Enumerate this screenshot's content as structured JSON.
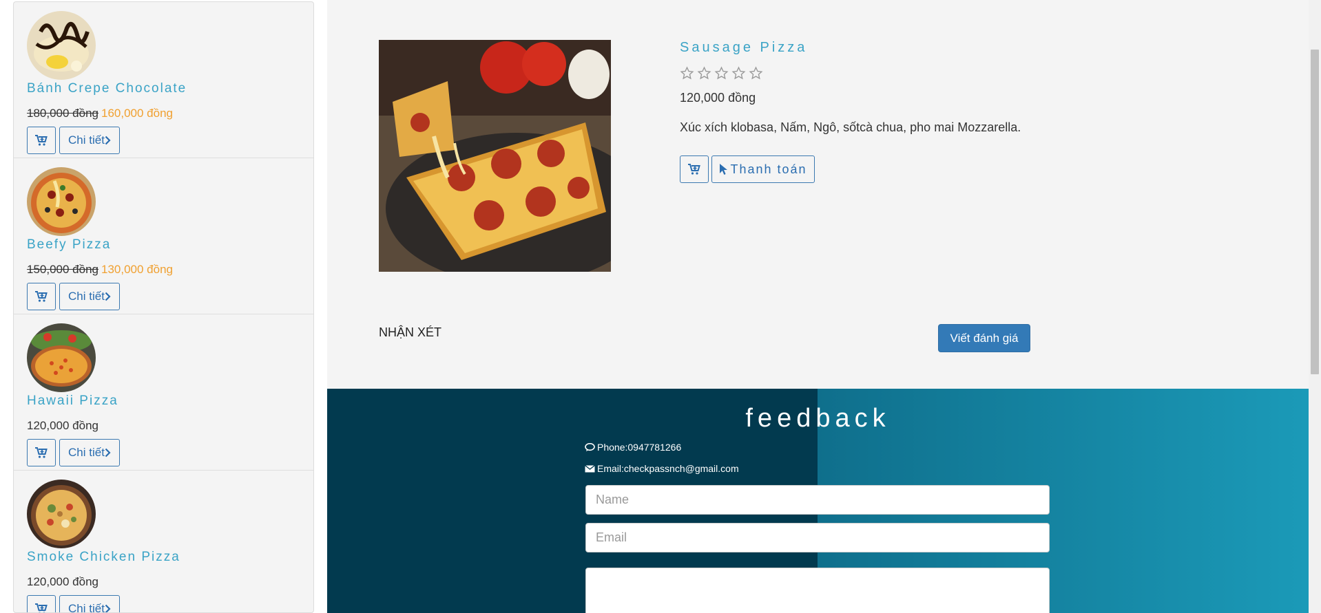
{
  "sidebar": {
    "items": [
      {
        "name": "Bánh Crepe Chocolate",
        "old_price": "180,000 đồng",
        "new_price": "160,000 đồng",
        "detail_label": "Chi tiết",
        "image": "crepe-chocolate"
      },
      {
        "name": "Beefy Pizza",
        "old_price": "150,000 đồng",
        "new_price": "130,000 đồng",
        "detail_label": "Chi tiết",
        "image": "beefy-pizza"
      },
      {
        "name": "Hawaii Pizza",
        "price": "120,000 đồng",
        "detail_label": "Chi tiết",
        "image": "hawaii-pizza"
      },
      {
        "name": "Smoke Chicken Pizza",
        "price": "120,000 đồng",
        "detail_label": "Chi tiết",
        "image": "smoke-chicken-pizza"
      }
    ]
  },
  "product": {
    "name": "Sausage Pizza",
    "rating": 0,
    "rating_max": 5,
    "price": "120,000 đồng",
    "description": "Xúc xích klobasa, Nấm, Ngô, sốtcà chua, pho mai Mozzarella.",
    "buy_label": "Thanh toán"
  },
  "reviews": {
    "label": "NHẬN XÉT",
    "write_button": "Viết đánh giá"
  },
  "feedback": {
    "title": "feedback",
    "phone": "Phone:0947781266",
    "email": "Email:checkpassnch@gmail.com",
    "name_placeholder": "Name",
    "email_placeholder": "Email"
  },
  "colors": {
    "accent": "#3aa3c6",
    "sale": "#f0a030",
    "primary_button": "#337ab7",
    "feedback_dark": "#023a4f",
    "feedback_light": "#1b9ab8"
  },
  "icons": [
    "cart-plus-icon",
    "chevron-right-icon",
    "star-empty-icon",
    "pointer-icon",
    "comment-icon",
    "envelope-icon"
  ]
}
